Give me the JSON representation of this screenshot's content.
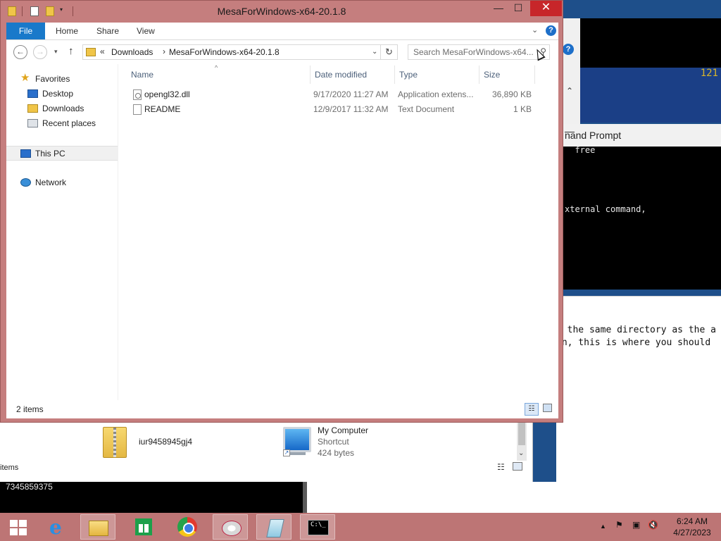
{
  "window": {
    "title": "MesaForWindows-x64-20.1.8",
    "controls": {
      "minimize": "—",
      "maximize": "☐",
      "close": "✕"
    }
  },
  "ribbon": {
    "tabs": [
      "File",
      "Home",
      "Share",
      "View"
    ],
    "expand_chevron": "⌄",
    "help": "?"
  },
  "address_bar": {
    "overflow": "«",
    "separator": "›",
    "crumbs": [
      "Downloads",
      "MesaForWindows-x64-20.1.8"
    ],
    "search_placeholder": "Search MesaForWindows-x64..."
  },
  "nav_pane": {
    "favorites_label": "Favorites",
    "favorites": [
      "Desktop",
      "Downloads",
      "Recent places"
    ],
    "this_pc": "This PC",
    "network": "Network"
  },
  "columns": [
    "Name",
    "Date modified",
    "Type",
    "Size"
  ],
  "files": [
    {
      "name": "opengl32.dll",
      "date": "9/17/2020 11:27 AM",
      "type": "Application extens...",
      "size": "36,890 KB",
      "icon": "dll-file-icon"
    },
    {
      "name": "README",
      "date": "12/9/2017 11:32 AM",
      "type": "Text Document",
      "size": "1 KB",
      "icon": "text-file-icon"
    }
  ],
  "status": {
    "item_count": "2 items"
  },
  "background": {
    "cmd_title": "nand Prompt",
    "cmd_lines": [
      "  free",
      "",
      "",
      "",
      "xternal command,"
    ],
    "corner_number": "121",
    "notepad_lines": [
      "n the same directory as the a",
      "on, this is where you should"
    ],
    "second_explorer": {
      "zip_name": "iur9458945gj4",
      "shortcut_name": "My Computer",
      "shortcut_type": "Shortcut",
      "shortcut_size": "424 bytes",
      "items_label": "items"
    },
    "cmd_strip_text": "7345859375"
  },
  "taskbar": {
    "apps": [
      "start",
      "internet-explorer",
      "file-explorer",
      "store",
      "chrome",
      "snipping-tool",
      "notepad",
      "command-prompt"
    ],
    "cmd_glyph": "C:\\_",
    "clock_time": "6:24 AM",
    "clock_date": "4/27/2023"
  },
  "colors": {
    "window_frame": "#c57e7e",
    "taskbar": "#bd7575",
    "file_tab": "#1979ca",
    "close_button": "#c7262a"
  }
}
